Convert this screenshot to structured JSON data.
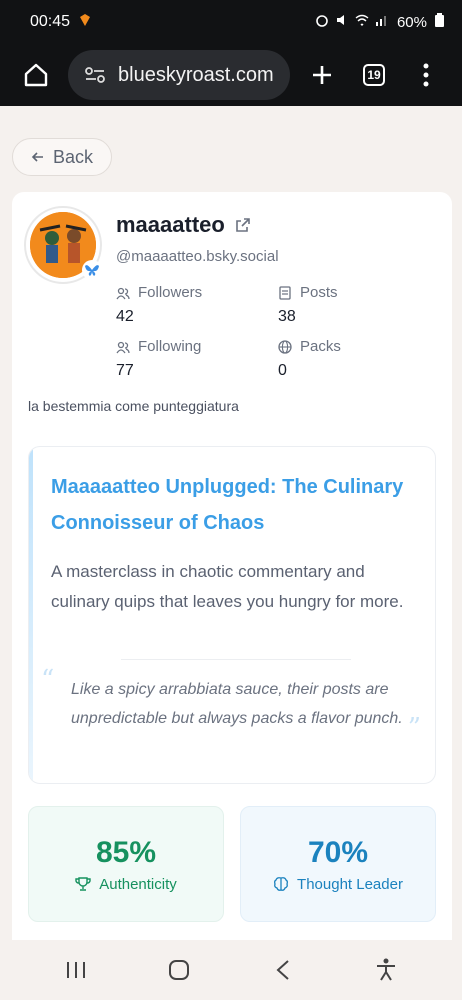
{
  "status": {
    "time": "00:45",
    "battery": "60%"
  },
  "browser": {
    "url": "blueskyroast.com",
    "tab_count": "19"
  },
  "back_label": "Back",
  "profile": {
    "username": "maaaatteo",
    "handle": "@maaaatteo.bsky.social",
    "stats": {
      "followers_label": "Followers",
      "followers": "42",
      "posts_label": "Posts",
      "posts": "38",
      "following_label": "Following",
      "following": "77",
      "packs_label": "Packs",
      "packs": "0"
    },
    "bio": "la bestemmia come punteggiatura"
  },
  "roast": {
    "title": "Maaaaatteo Unplugged: The Culinary Connoisseur of Chaos",
    "description": "A masterclass in chaotic commentary and culinary quips that leaves you hungry for more.",
    "quote": "Like a spicy arrabbiata sauce, their posts are unpredictable but always packs a flavor punch."
  },
  "metrics": [
    {
      "value": "85%",
      "label": "Authenticity",
      "icon": "trophy-icon",
      "color": "#16915f"
    },
    {
      "value": "70%",
      "label": "Thought Leader",
      "icon": "brain-icon",
      "color": "#1b82be"
    }
  ],
  "colors": {
    "accent_blue": "#3b9ee6",
    "green": "#16915f",
    "blue": "#1b82be"
  }
}
